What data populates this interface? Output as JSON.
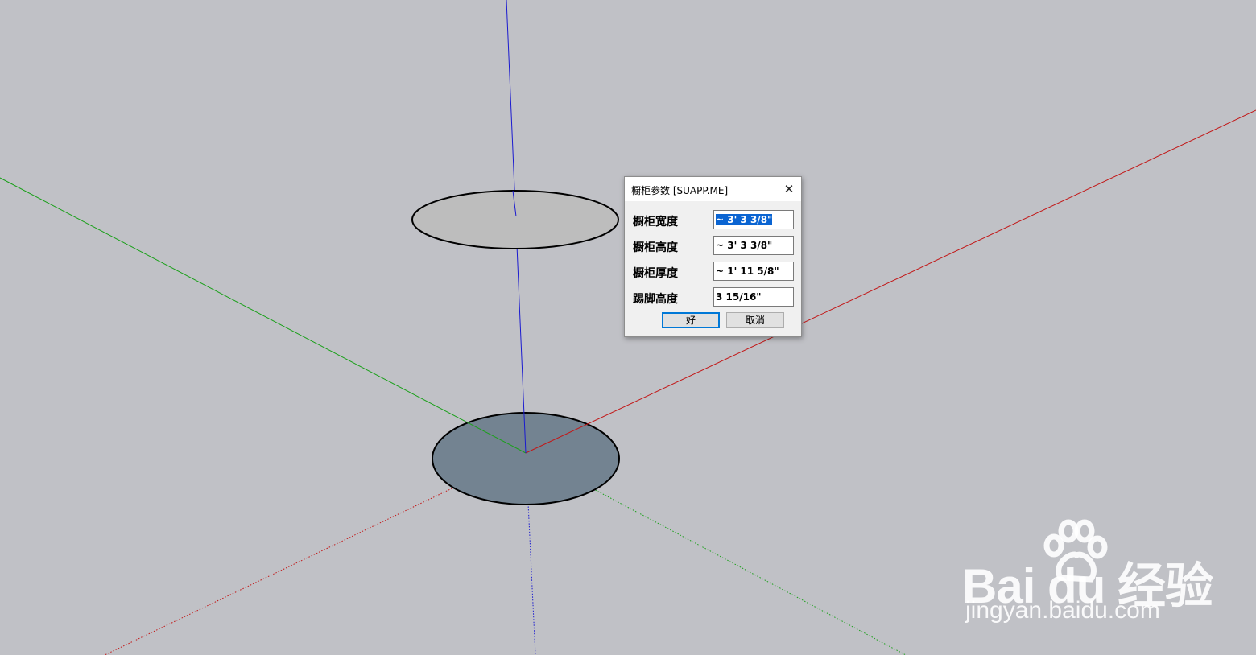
{
  "scene": {
    "background": "#c0c1c6",
    "axis_colors": {
      "red": "#c21818",
      "green": "#1aa01a",
      "blue": "#1a1ad0"
    },
    "upper_circle_fill": "#bdbdbd",
    "lower_circle_fill": "#738391"
  },
  "dialog": {
    "title": "橱柜参数 [SUAPP.ME]",
    "close_glyph": "✕",
    "fields": [
      {
        "label": "橱柜宽度",
        "value": "~ 3' 3 3/8\"",
        "selected": true
      },
      {
        "label": "橱柜高度",
        "value": "~ 3' 3 3/8\"",
        "selected": false
      },
      {
        "label": "橱柜厚度",
        "value": "~ 1' 11 5/8\"",
        "selected": false
      },
      {
        "label": "踢脚高度",
        "value": "3 15/16\"",
        "selected": false
      }
    ],
    "ok_label": "好",
    "cancel_label": "取消",
    "accent": "#0078d7"
  },
  "watermark": {
    "brand": "Bai  du 经验",
    "url": "jingyan.baidu.com",
    "icon": "baidu-paw-icon"
  }
}
